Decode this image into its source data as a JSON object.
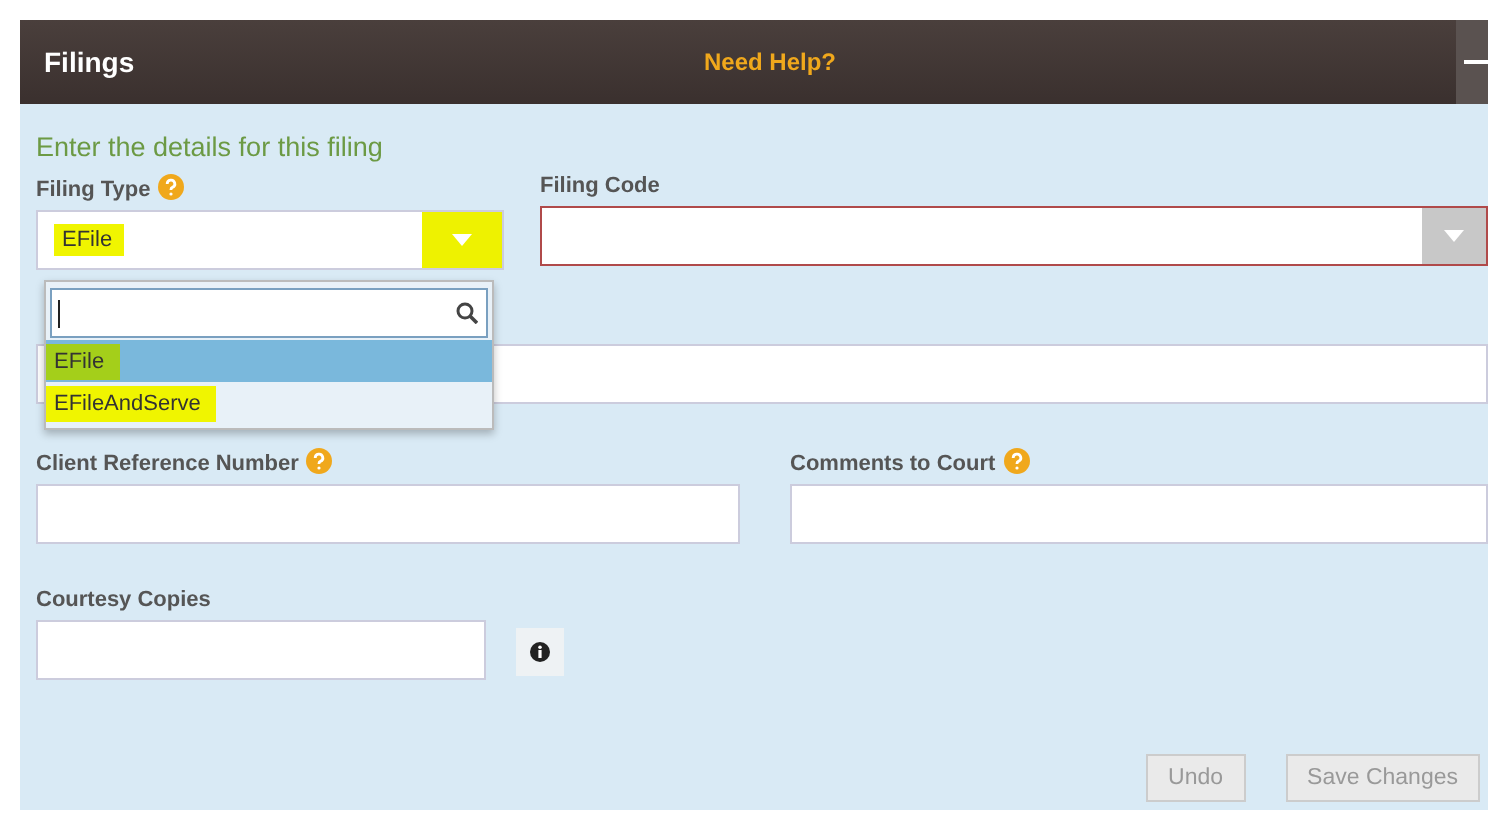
{
  "header": {
    "title": "Filings",
    "help_link": "Need Help?"
  },
  "form": {
    "heading": "Enter the details for this filing",
    "filing_type": {
      "label": "Filing Type",
      "help": true,
      "value": "EFile",
      "value_highlighted": true,
      "arrow_highlighted": true,
      "open": true,
      "options": [
        {
          "label": "EFile",
          "selected": true,
          "highlighted": true
        },
        {
          "label": "EFileAndServe",
          "selected": false,
          "highlighted": true
        }
      ]
    },
    "filing_code": {
      "label": "Filing Code",
      "help": false,
      "invalid": true
    },
    "client_reference": {
      "label": "Client Reference Number",
      "help": true
    },
    "comments": {
      "label": "Comments to Court",
      "help": true
    },
    "courtesy_copies": {
      "label": "Courtesy Copies",
      "help": false
    }
  },
  "buttons": [
    {
      "label": "Undo",
      "disabled": true
    },
    {
      "label": "Save Changes",
      "disabled": true
    }
  ]
}
